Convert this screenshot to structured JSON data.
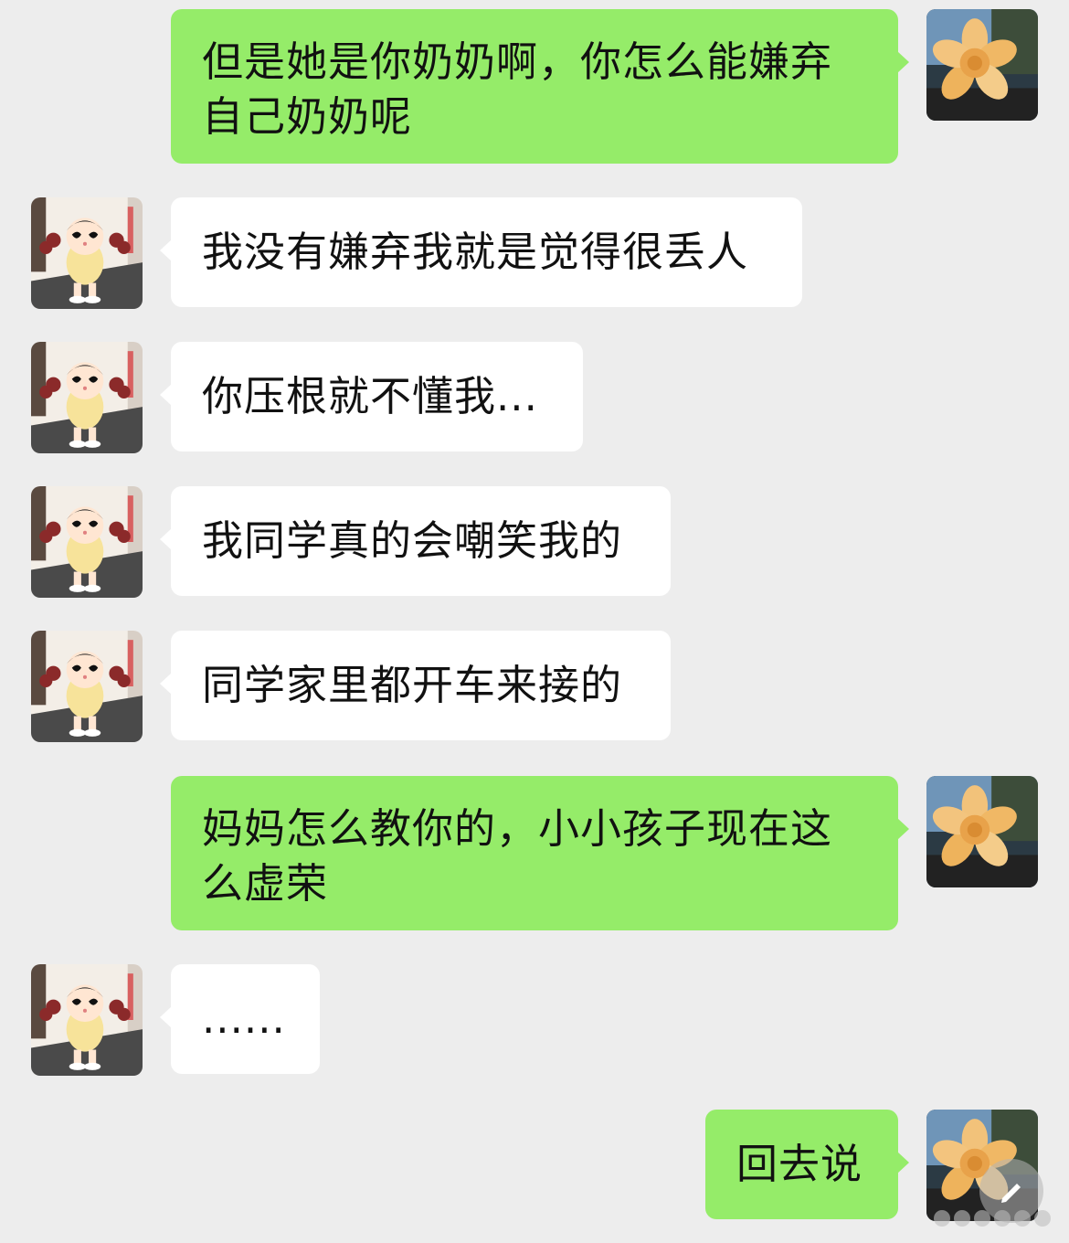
{
  "chat": {
    "messages": [
      {
        "side": "sent",
        "text": "但是她是你奶奶啊，你怎么能嫌弃\n自己奶奶呢"
      },
      {
        "side": "recv",
        "text": "我没有嫌弃我就是觉得很丢人"
      },
      {
        "side": "recv",
        "text": "你压根就不懂我..."
      },
      {
        "side": "recv",
        "text": "我同学真的会嘲笑我的"
      },
      {
        "side": "recv",
        "text": "同学家里都开车来接的"
      },
      {
        "side": "sent",
        "text": "妈妈怎么教你的，小小孩子现在这\n么虚荣"
      },
      {
        "side": "recv",
        "text": "......"
      },
      {
        "side": "sent",
        "text": "回去说"
      }
    ]
  },
  "avatars": {
    "self": "sunflower-avatar",
    "other": "cartoon-girl-avatar"
  },
  "colors": {
    "background": "#ededed",
    "sent_bubble": "#95ec69",
    "recv_bubble": "#ffffff"
  }
}
